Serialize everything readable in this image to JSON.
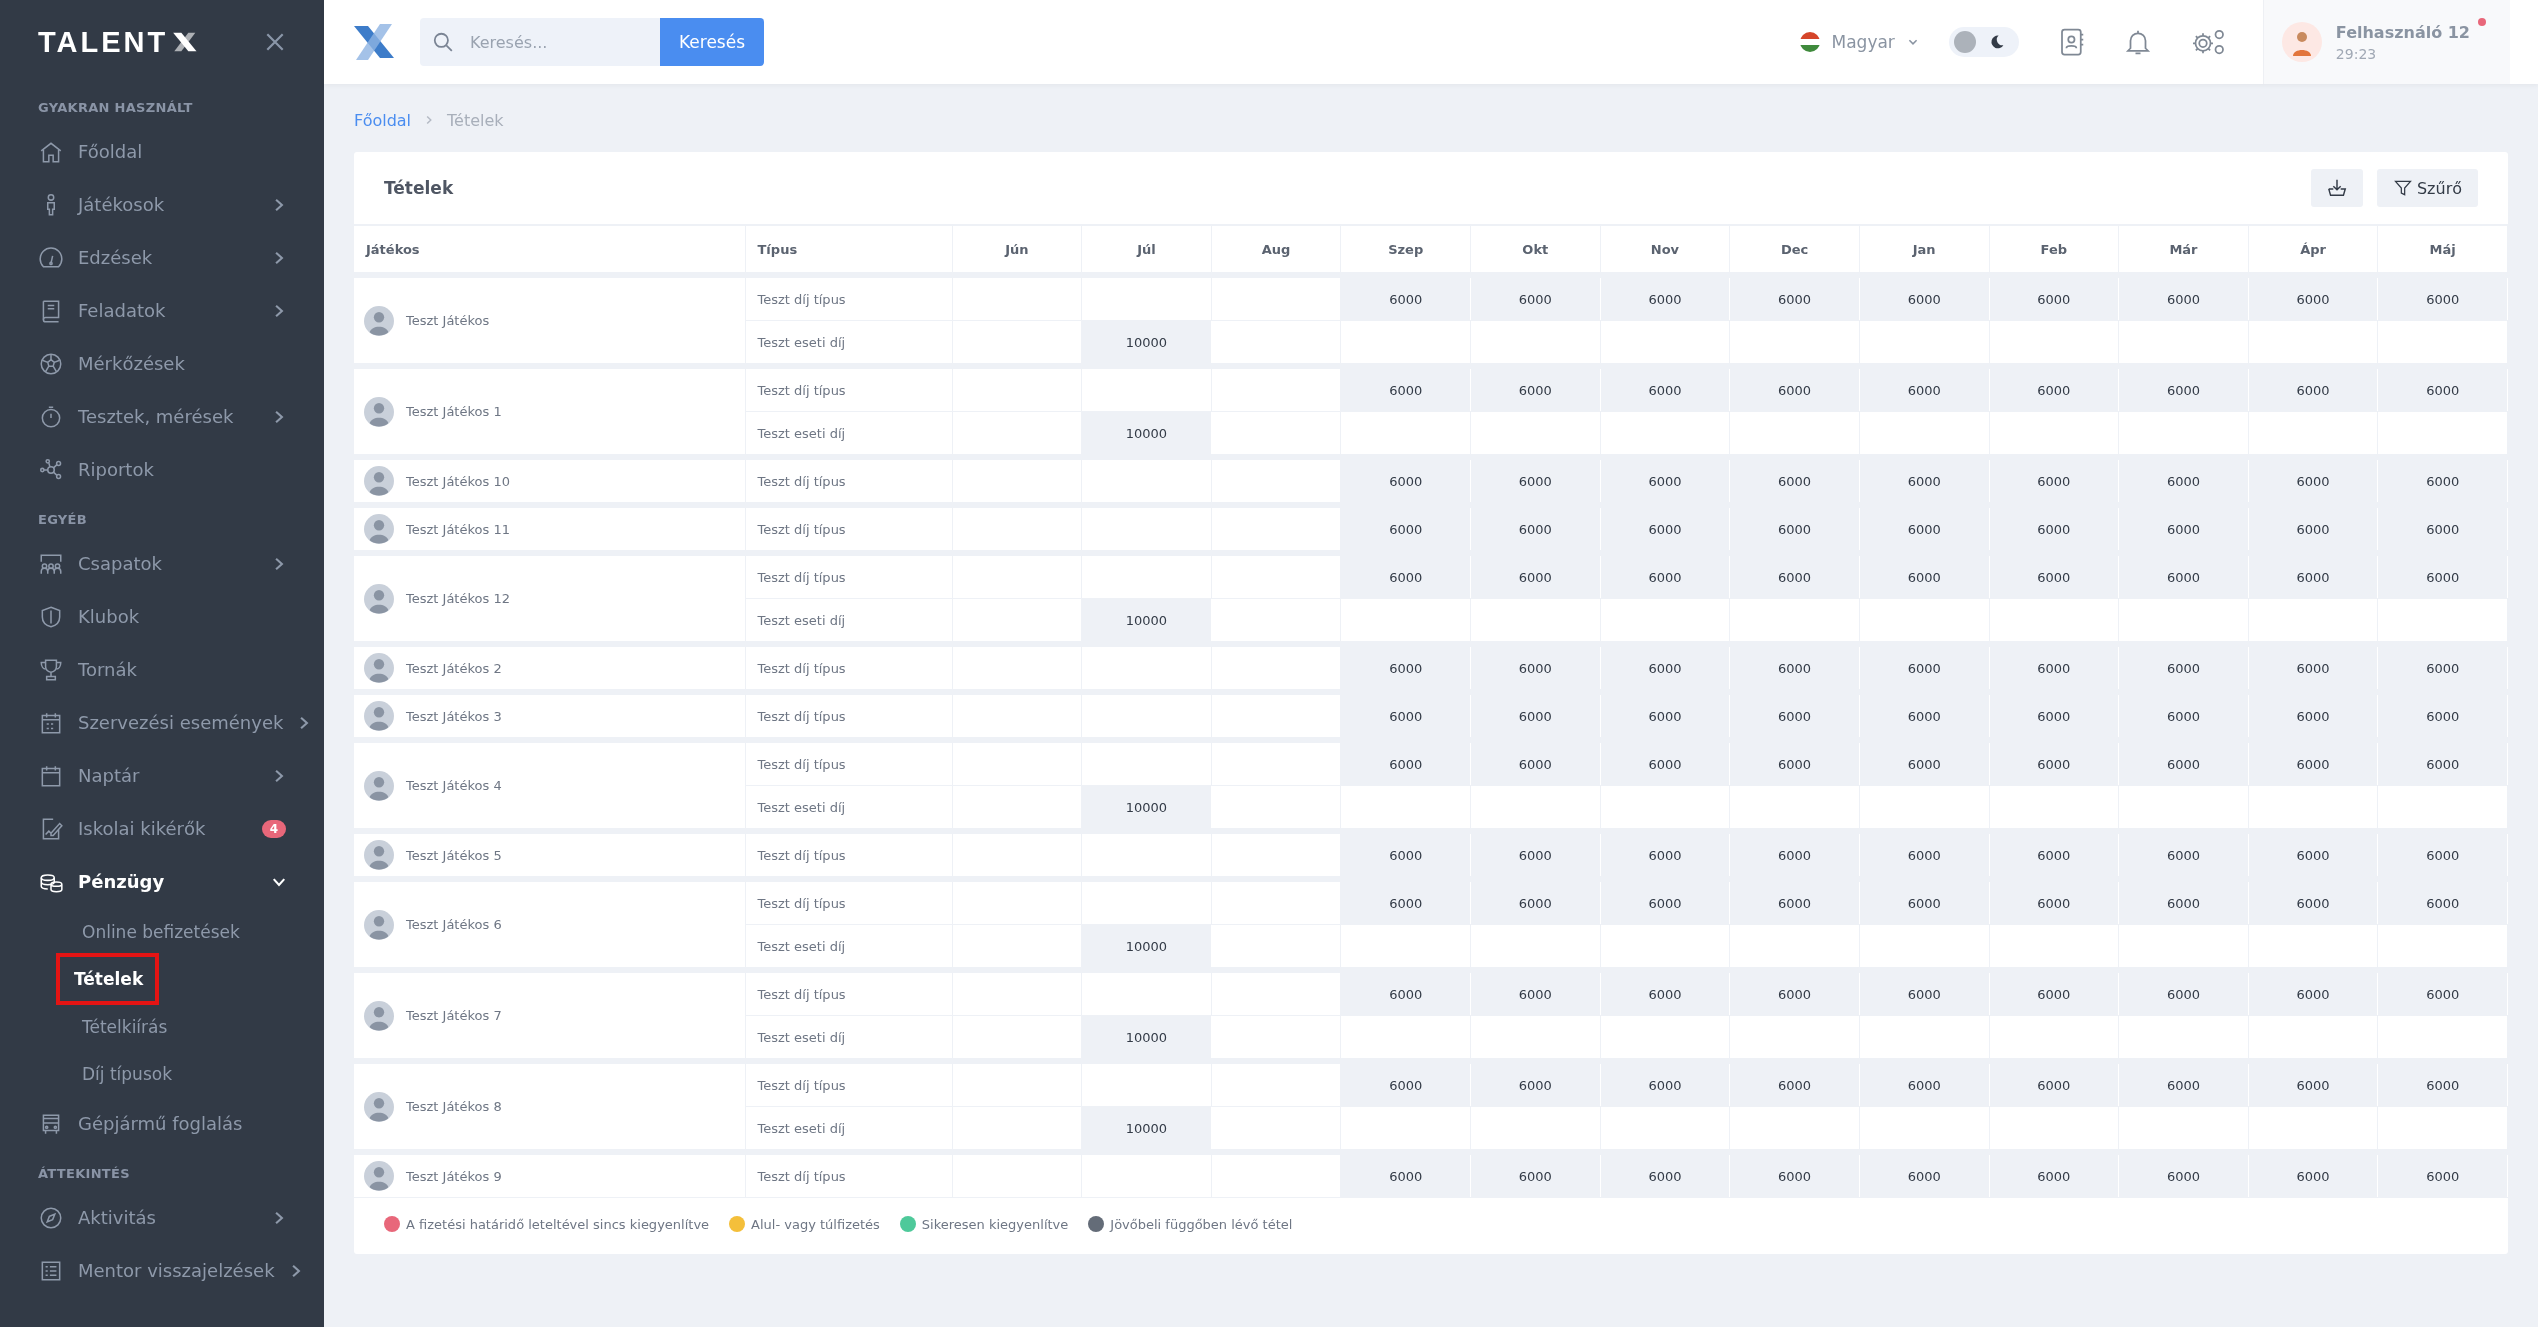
{
  "sidebar": {
    "brand": "TALENT",
    "sections": [
      {
        "title": "GYAKRAN HASZNÁLT",
        "items": [
          {
            "label": "Főoldal",
            "expandable": false,
            "selected": false
          },
          {
            "label": "Játékosok",
            "expandable": true,
            "expanded": false,
            "selected": false
          },
          {
            "label": "Edzések",
            "expandable": true,
            "expanded": false,
            "selected": false
          },
          {
            "label": "Feladatok",
            "expandable": true,
            "expanded": false,
            "selected": false
          },
          {
            "label": "Mérkőzések",
            "expandable": false,
            "selected": false
          },
          {
            "label": "Tesztek, mérések",
            "expandable": true,
            "expanded": false,
            "selected": false
          },
          {
            "label": "Riportok",
            "expandable": false,
            "selected": false
          }
        ]
      },
      {
        "title": "EGYÉB",
        "items": [
          {
            "label": "Csapatok",
            "expandable": true,
            "expanded": false,
            "selected": false
          },
          {
            "label": "Klubok",
            "expandable": false,
            "selected": false
          },
          {
            "label": "Tornák",
            "expandable": false,
            "selected": false
          },
          {
            "label": "Szervezési események",
            "expandable": true,
            "expanded": false,
            "selected": false
          },
          {
            "label": "Naptár",
            "expandable": true,
            "expanded": false,
            "selected": false
          },
          {
            "label": "Iskolai kikérők",
            "expandable": false,
            "selected": false,
            "badge": "4"
          },
          {
            "label": "Pénzügy",
            "expandable": true,
            "expanded": true,
            "selected": true,
            "children": [
              {
                "label": "Online befizetések",
                "selected": false
              },
              {
                "label": "Tételek",
                "selected": true
              },
              {
                "label": "Tételkiírás",
                "selected": false
              },
              {
                "label": "Díj típusok",
                "selected": false
              }
            ]
          },
          {
            "label": "Gépjármű foglalás",
            "expandable": false,
            "selected": false
          }
        ]
      },
      {
        "title": "ÁTTEKINTÉS",
        "items": [
          {
            "label": "Aktivitás",
            "expandable": true,
            "expanded": false,
            "selected": false
          },
          {
            "label": "Mentor visszajelzések",
            "expandable": true,
            "expanded": false,
            "selected": false
          }
        ]
      }
    ]
  },
  "topbar": {
    "search": {
      "placeholder": "Keresés..."
    },
    "search_button": "Keresés",
    "language": "Magyar",
    "dark_mode": false,
    "user": {
      "name": "Felhasználó 12",
      "time": "29:23"
    }
  },
  "breadcrumb": [
    {
      "label": "Főoldal",
      "kind": "link"
    },
    {
      "label": "Tételek",
      "kind": "current"
    }
  ],
  "card": {
    "title": "Tételek",
    "filter_button": "Szűrő"
  },
  "table": {
    "columns": [
      "Játékos",
      "Típus",
      "Jún",
      "Júl",
      "Aug",
      "Szep",
      "Okt",
      "Nov",
      "Dec",
      "Jan",
      "Feb",
      "Már",
      "Ápr",
      "Máj"
    ],
    "rows": [
      {
        "player": "Teszt Játékos",
        "fees": [
          {
            "type": "Teszt díj típus",
            "cells": [
              {
                "filled": false
              },
              {
                "filled": false
              },
              {
                "filled": false
              },
              {
                "filled": true,
                "amount": "6000"
              },
              {
                "filled": true,
                "amount": "6000"
              },
              {
                "filled": true,
                "amount": "6000"
              },
              {
                "filled": true,
                "amount": "6000"
              },
              {
                "filled": true,
                "amount": "6000"
              },
              {
                "filled": true,
                "amount": "6000"
              },
              {
                "filled": true,
                "amount": "6000"
              },
              {
                "filled": true,
                "amount": "6000"
              },
              {
                "filled": true,
                "amount": "6000"
              }
            ]
          },
          {
            "type": "Teszt eseti díj",
            "cells": [
              {
                "filled": false
              },
              {
                "filled": true,
                "amount": "10000"
              },
              {
                "filled": false
              },
              {
                "filled": false
              },
              {
                "filled": false
              },
              {
                "filled": false
              },
              {
                "filled": false
              },
              {
                "filled": false
              },
              {
                "filled": false
              },
              {
                "filled": false
              },
              {
                "filled": false
              },
              {
                "filled": false
              }
            ]
          }
        ]
      },
      {
        "player": "Teszt Játékos 1",
        "fees": [
          {
            "type": "Teszt díj típus",
            "cells": [
              {
                "filled": false
              },
              {
                "filled": false
              },
              {
                "filled": false
              },
              {
                "filled": true,
                "amount": "6000"
              },
              {
                "filled": true,
                "amount": "6000"
              },
              {
                "filled": true,
                "amount": "6000"
              },
              {
                "filled": true,
                "amount": "6000"
              },
              {
                "filled": true,
                "amount": "6000"
              },
              {
                "filled": true,
                "amount": "6000"
              },
              {
                "filled": true,
                "amount": "6000"
              },
              {
                "filled": true,
                "amount": "6000"
              },
              {
                "filled": true,
                "amount": "6000"
              }
            ]
          },
          {
            "type": "Teszt eseti díj",
            "cells": [
              {
                "filled": false
              },
              {
                "filled": true,
                "amount": "10000"
              },
              {
                "filled": false
              },
              {
                "filled": false
              },
              {
                "filled": false
              },
              {
                "filled": false
              },
              {
                "filled": false
              },
              {
                "filled": false
              },
              {
                "filled": false
              },
              {
                "filled": false
              },
              {
                "filled": false
              },
              {
                "filled": false
              }
            ]
          }
        ]
      },
      {
        "player": "Teszt Játékos 10",
        "fees": [
          {
            "type": "Teszt díj típus",
            "cells": [
              {
                "filled": false
              },
              {
                "filled": false
              },
              {
                "filled": false
              },
              {
                "filled": true,
                "amount": "6000"
              },
              {
                "filled": true,
                "amount": "6000"
              },
              {
                "filled": true,
                "amount": "6000"
              },
              {
                "filled": true,
                "amount": "6000"
              },
              {
                "filled": true,
                "amount": "6000"
              },
              {
                "filled": true,
                "amount": "6000"
              },
              {
                "filled": true,
                "amount": "6000"
              },
              {
                "filled": true,
                "amount": "6000"
              },
              {
                "filled": true,
                "amount": "6000"
              }
            ]
          }
        ]
      },
      {
        "player": "Teszt Játékos 11",
        "fees": [
          {
            "type": "Teszt díj típus",
            "cells": [
              {
                "filled": false
              },
              {
                "filled": false
              },
              {
                "filled": false
              },
              {
                "filled": true,
                "amount": "6000"
              },
              {
                "filled": true,
                "amount": "6000"
              },
              {
                "filled": true,
                "amount": "6000"
              },
              {
                "filled": true,
                "amount": "6000"
              },
              {
                "filled": true,
                "amount": "6000"
              },
              {
                "filled": true,
                "amount": "6000"
              },
              {
                "filled": true,
                "amount": "6000"
              },
              {
                "filled": true,
                "amount": "6000"
              },
              {
                "filled": true,
                "amount": "6000"
              }
            ]
          }
        ]
      },
      {
        "player": "Teszt Játékos 12",
        "fees": [
          {
            "type": "Teszt díj típus",
            "cells": [
              {
                "filled": false
              },
              {
                "filled": false
              },
              {
                "filled": false
              },
              {
                "filled": true,
                "amount": "6000"
              },
              {
                "filled": true,
                "amount": "6000"
              },
              {
                "filled": true,
                "amount": "6000"
              },
              {
                "filled": true,
                "amount": "6000"
              },
              {
                "filled": true,
                "amount": "6000"
              },
              {
                "filled": true,
                "amount": "6000"
              },
              {
                "filled": true,
                "amount": "6000"
              },
              {
                "filled": true,
                "amount": "6000"
              },
              {
                "filled": true,
                "amount": "6000"
              }
            ]
          },
          {
            "type": "Teszt eseti díj",
            "cells": [
              {
                "filled": false
              },
              {
                "filled": true,
                "amount": "10000"
              },
              {
                "filled": false
              },
              {
                "filled": false
              },
              {
                "filled": false
              },
              {
                "filled": false
              },
              {
                "filled": false
              },
              {
                "filled": false
              },
              {
                "filled": false
              },
              {
                "filled": false
              },
              {
                "filled": false
              },
              {
                "filled": false
              }
            ]
          }
        ]
      },
      {
        "player": "Teszt Játékos 2",
        "fees": [
          {
            "type": "Teszt díj típus",
            "cells": [
              {
                "filled": false
              },
              {
                "filled": false
              },
              {
                "filled": false
              },
              {
                "filled": true,
                "amount": "6000"
              },
              {
                "filled": true,
                "amount": "6000"
              },
              {
                "filled": true,
                "amount": "6000"
              },
              {
                "filled": true,
                "amount": "6000"
              },
              {
                "filled": true,
                "amount": "6000"
              },
              {
                "filled": true,
                "amount": "6000"
              },
              {
                "filled": true,
                "amount": "6000"
              },
              {
                "filled": true,
                "amount": "6000"
              },
              {
                "filled": true,
                "amount": "6000"
              }
            ]
          }
        ]
      },
      {
        "player": "Teszt Játékos 3",
        "fees": [
          {
            "type": "Teszt díj típus",
            "cells": [
              {
                "filled": false
              },
              {
                "filled": false
              },
              {
                "filled": false
              },
              {
                "filled": true,
                "amount": "6000"
              },
              {
                "filled": true,
                "amount": "6000"
              },
              {
                "filled": true,
                "amount": "6000"
              },
              {
                "filled": true,
                "amount": "6000"
              },
              {
                "filled": true,
                "amount": "6000"
              },
              {
                "filled": true,
                "amount": "6000"
              },
              {
                "filled": true,
                "amount": "6000"
              },
              {
                "filled": true,
                "amount": "6000"
              },
              {
                "filled": true,
                "amount": "6000"
              }
            ]
          }
        ]
      },
      {
        "player": "Teszt Játékos 4",
        "fees": [
          {
            "type": "Teszt díj típus",
            "cells": [
              {
                "filled": false
              },
              {
                "filled": false
              },
              {
                "filled": false
              },
              {
                "filled": true,
                "amount": "6000"
              },
              {
                "filled": true,
                "amount": "6000"
              },
              {
                "filled": true,
                "amount": "6000"
              },
              {
                "filled": true,
                "amount": "6000"
              },
              {
                "filled": true,
                "amount": "6000"
              },
              {
                "filled": true,
                "amount": "6000"
              },
              {
                "filled": true,
                "amount": "6000"
              },
              {
                "filled": true,
                "amount": "6000"
              },
              {
                "filled": true,
                "amount": "6000"
              }
            ]
          },
          {
            "type": "Teszt eseti díj",
            "cells": [
              {
                "filled": false
              },
              {
                "filled": true,
                "amount": "10000"
              },
              {
                "filled": false
              },
              {
                "filled": false
              },
              {
                "filled": false
              },
              {
                "filled": false
              },
              {
                "filled": false
              },
              {
                "filled": false
              },
              {
                "filled": false
              },
              {
                "filled": false
              },
              {
                "filled": false
              },
              {
                "filled": false
              }
            ]
          }
        ]
      },
      {
        "player": "Teszt Játékos 5",
        "fees": [
          {
            "type": "Teszt díj típus",
            "cells": [
              {
                "filled": false
              },
              {
                "filled": false
              },
              {
                "filled": false
              },
              {
                "filled": true,
                "amount": "6000"
              },
              {
                "filled": true,
                "amount": "6000"
              },
              {
                "filled": true,
                "amount": "6000"
              },
              {
                "filled": true,
                "amount": "6000"
              },
              {
                "filled": true,
                "amount": "6000"
              },
              {
                "filled": true,
                "amount": "6000"
              },
              {
                "filled": true,
                "amount": "6000"
              },
              {
                "filled": true,
                "amount": "6000"
              },
              {
                "filled": true,
                "amount": "6000"
              }
            ]
          }
        ]
      },
      {
        "player": "Teszt Játékos 6",
        "fees": [
          {
            "type": "Teszt díj típus",
            "cells": [
              {
                "filled": false
              },
              {
                "filled": false
              },
              {
                "filled": false
              },
              {
                "filled": true,
                "amount": "6000"
              },
              {
                "filled": true,
                "amount": "6000"
              },
              {
                "filled": true,
                "amount": "6000"
              },
              {
                "filled": true,
                "amount": "6000"
              },
              {
                "filled": true,
                "amount": "6000"
              },
              {
                "filled": true,
                "amount": "6000"
              },
              {
                "filled": true,
                "amount": "6000"
              },
              {
                "filled": true,
                "amount": "6000"
              },
              {
                "filled": true,
                "amount": "6000"
              }
            ]
          },
          {
            "type": "Teszt eseti díj",
            "cells": [
              {
                "filled": false
              },
              {
                "filled": true,
                "amount": "10000"
              },
              {
                "filled": false
              },
              {
                "filled": false
              },
              {
                "filled": false
              },
              {
                "filled": false
              },
              {
                "filled": false
              },
              {
                "filled": false
              },
              {
                "filled": false
              },
              {
                "filled": false
              },
              {
                "filled": false
              },
              {
                "filled": false
              }
            ]
          }
        ]
      },
      {
        "player": "Teszt Játékos 7",
        "fees": [
          {
            "type": "Teszt díj típus",
            "cells": [
              {
                "filled": false
              },
              {
                "filled": false
              },
              {
                "filled": false
              },
              {
                "filled": true,
                "amount": "6000"
              },
              {
                "filled": true,
                "amount": "6000"
              },
              {
                "filled": true,
                "amount": "6000"
              },
              {
                "filled": true,
                "amount": "6000"
              },
              {
                "filled": true,
                "amount": "6000"
              },
              {
                "filled": true,
                "amount": "6000"
              },
              {
                "filled": true,
                "amount": "6000"
              },
              {
                "filled": true,
                "amount": "6000"
              },
              {
                "filled": true,
                "amount": "6000"
              }
            ]
          },
          {
            "type": "Teszt eseti díj",
            "cells": [
              {
                "filled": false
              },
              {
                "filled": true,
                "amount": "10000"
              },
              {
                "filled": false
              },
              {
                "filled": false
              },
              {
                "filled": false
              },
              {
                "filled": false
              },
              {
                "filled": false
              },
              {
                "filled": false
              },
              {
                "filled": false
              },
              {
                "filled": false
              },
              {
                "filled": false
              },
              {
                "filled": false
              }
            ]
          }
        ]
      },
      {
        "player": "Teszt Játékos 8",
        "fees": [
          {
            "type": "Teszt díj típus",
            "cells": [
              {
                "filled": false
              },
              {
                "filled": false
              },
              {
                "filled": false
              },
              {
                "filled": true,
                "amount": "6000"
              },
              {
                "filled": true,
                "amount": "6000"
              },
              {
                "filled": true,
                "amount": "6000"
              },
              {
                "filled": true,
                "amount": "6000"
              },
              {
                "filled": true,
                "amount": "6000"
              },
              {
                "filled": true,
                "amount": "6000"
              },
              {
                "filled": true,
                "amount": "6000"
              },
              {
                "filled": true,
                "amount": "6000"
              },
              {
                "filled": true,
                "amount": "6000"
              }
            ]
          },
          {
            "type": "Teszt eseti díj",
            "cells": [
              {
                "filled": false
              },
              {
                "filled": true,
                "amount": "10000"
              },
              {
                "filled": false
              },
              {
                "filled": false
              },
              {
                "filled": false
              },
              {
                "filled": false
              },
              {
                "filled": false
              },
              {
                "filled": false
              },
              {
                "filled": false
              },
              {
                "filled": false
              },
              {
                "filled": false
              },
              {
                "filled": false
              }
            ]
          }
        ]
      },
      {
        "player": "Teszt Játékos 9",
        "fees": [
          {
            "type": "Teszt díj típus",
            "cells": [
              {
                "filled": false
              },
              {
                "filled": false
              },
              {
                "filled": false
              },
              {
                "filled": true,
                "amount": "6000"
              },
              {
                "filled": true,
                "amount": "6000"
              },
              {
                "filled": true,
                "amount": "6000"
              },
              {
                "filled": true,
                "amount": "6000"
              },
              {
                "filled": true,
                "amount": "6000"
              },
              {
                "filled": true,
                "amount": "6000"
              },
              {
                "filled": true,
                "amount": "6000"
              },
              {
                "filled": true,
                "amount": "6000"
              },
              {
                "filled": true,
                "amount": "6000"
              }
            ]
          }
        ]
      }
    ]
  },
  "legend": [
    {
      "label": "A fizetési határidő leteltével sincs kiegyenlítve",
      "color": "#e8677a"
    },
    {
      "label": "Alul- vagy túlfizetés",
      "color": "#f4bf3a"
    },
    {
      "label": "Sikeresen kiegyenlítve",
      "color": "#4ec99a"
    },
    {
      "label": "Jövőbeli függőben lévő tétel",
      "color": "#646c78"
    }
  ]
}
